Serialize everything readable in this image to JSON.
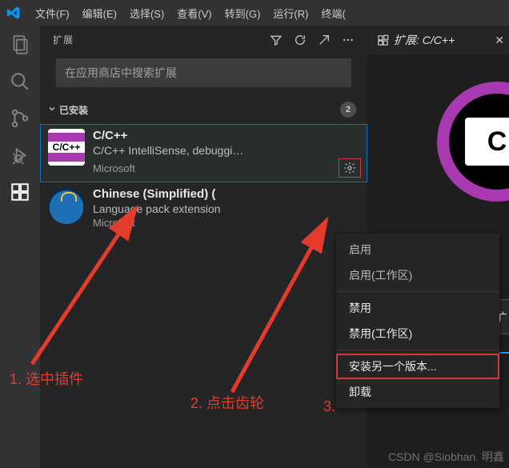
{
  "menubar": {
    "items": [
      "文件(F)",
      "编辑(E)",
      "选择(S)",
      "查看(V)",
      "转到(G)",
      "运行(R)",
      "终端("
    ]
  },
  "sidebar": {
    "title": "扩展",
    "search_placeholder": "在应用商店中搜索扩展",
    "section": {
      "label": "已安装",
      "badge": "2"
    }
  },
  "extensions": [
    {
      "name": "C/C++",
      "desc": "C/C++ IntelliSense, debuggi…",
      "publisher": "Microsoft"
    },
    {
      "name": "Chinese (Simplified) (",
      "desc": "Language pack extension",
      "publisher": "Microsoft"
    }
  ],
  "editor": {
    "tab_title": "扩展: C/C++",
    "logo_text": "C"
  },
  "context_menu": {
    "items": [
      {
        "label": "启用",
        "enabled": false
      },
      {
        "label": "启用(工作区)",
        "enabled": false
      },
      {
        "sep": true
      },
      {
        "label": "禁用",
        "enabled": true
      },
      {
        "label": "禁用(工作区)",
        "enabled": true
      },
      {
        "sep": true
      },
      {
        "label": "安装另一个版本...",
        "enabled": true,
        "highlight": true
      },
      {
        "label": "卸载",
        "enabled": true
      }
    ]
  },
  "annotations": {
    "step1": "1.   选中插件",
    "step2": "2. 点击齿轮",
    "step3": "3."
  },
  "watermark": "CSDN @Siobhan. 明鑫",
  "side_tab": "扩"
}
